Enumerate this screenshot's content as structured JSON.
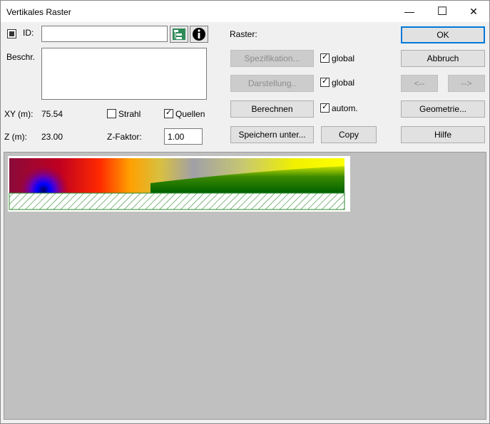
{
  "window": {
    "title": "Vertikales Raster",
    "minimize_glyph": "—",
    "maximize_glyph": "☐",
    "close_glyph": "✕"
  },
  "form": {
    "id_label": "ID:",
    "id_value": "",
    "beschr_label": "Beschr.",
    "beschr_value": "",
    "xy_label": "XY (m):",
    "xy_value": "75.54",
    "z_label": "Z (m):",
    "z_value": "23.00",
    "strahl_label": "Strahl",
    "strahl_checked": false,
    "quellen_label": "Quellen",
    "quellen_checked": true,
    "zfaktor_label": "Z-Faktor:",
    "zfaktor_value": "1.00"
  },
  "raster": {
    "label": "Raster:",
    "spezifikation_button": "Spezifikation...",
    "darstellung_button": "Darstellung..",
    "berechnen_button": "Berechnen",
    "speichern_button": "Speichern unter...",
    "copy_button": "Copy",
    "global1_label": "global",
    "global1_checked": true,
    "global2_label": "global",
    "global2_checked": true,
    "autom_label": "autom.",
    "autom_checked": true
  },
  "actions": {
    "ok_button": "OK",
    "abbruch_button": "Abbruch",
    "prev_button": "<--",
    "next_button": "-->",
    "geometrie_button": "Geometrie...",
    "hilfe_button": "Hilfe"
  },
  "icons": {
    "tree": "tree-icon",
    "info": "info-icon"
  }
}
